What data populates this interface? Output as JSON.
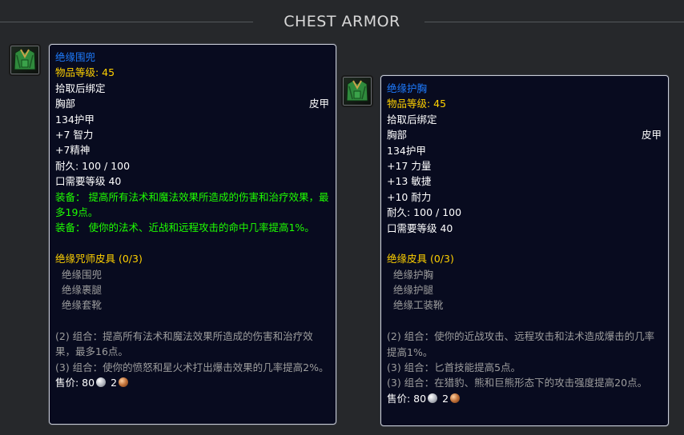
{
  "section_title": "CHEST ARMOR",
  "items": [
    {
      "icon_name": "chest-armor-icon",
      "name": "绝缘围兜",
      "item_level": "物品等级: 45",
      "bind": "拾取后绑定",
      "slot": "胸部",
      "armor_type": "皮甲",
      "armor": "134护甲",
      "stats": [
        "+7 智力",
        "+7精神"
      ],
      "durability": "耐久: 100 / 100",
      "requires": "口需要等级 40",
      "equip_effects": [
        "装备： 提高所有法术和魔法效果所造成的伤害和治疗效果，最多19点。",
        "装备： 使你的法术、近战和远程攻击的命中几率提高1%。"
      ],
      "set_name": "绝缘咒师皮具 (0/3)",
      "set_items": [
        "绝缘围兜",
        "绝缘裹腿",
        "绝缘套靴"
      ],
      "set_bonuses": [
        "(2) 组合：提高所有法术和魔法效果所造成的伤害和治疗效果，最多16点。",
        "(3) 组合：使你的愤怒和星火术打出爆击效果的几率提高2%。"
      ],
      "sell_label": "售价: 80",
      "sell_copper": "2"
    },
    {
      "icon_name": "chest-armor-icon",
      "name": "绝缘护胸",
      "item_level": "物品等级: 45",
      "bind": "拾取后绑定",
      "slot": "胸部",
      "armor_type": "皮甲",
      "armor": "134护甲",
      "stats": [
        "+17 力量",
        "+13 敏捷",
        "+10 耐力"
      ],
      "durability": "耐久: 100 / 100",
      "requires": "口需要等级 40",
      "set_name": "绝缘皮具 (0/3)",
      "set_items": [
        "绝缘护胸",
        "绝缘护腿",
        "绝缘工装靴"
      ],
      "set_bonuses": [
        "(2) 组合：使你的近战攻击、远程攻击和法术造成爆击的几率提高1%。",
        "(3) 组合：匕首技能提高5点。",
        "(3) 组合：在猎豹、熊和巨熊形态下的攻击强度提高20点。"
      ],
      "sell_label": "售价: 80",
      "sell_copper": "2"
    }
  ],
  "colors": {
    "item_name": "#1e7cff",
    "item_level": "#ffd100",
    "equip_effect": "#1eff00",
    "set_name": "#ffd100",
    "set_inactive": "#9d9d9d",
    "tooltip_bg": "#080b1f",
    "page_bg": "#26282b"
  }
}
